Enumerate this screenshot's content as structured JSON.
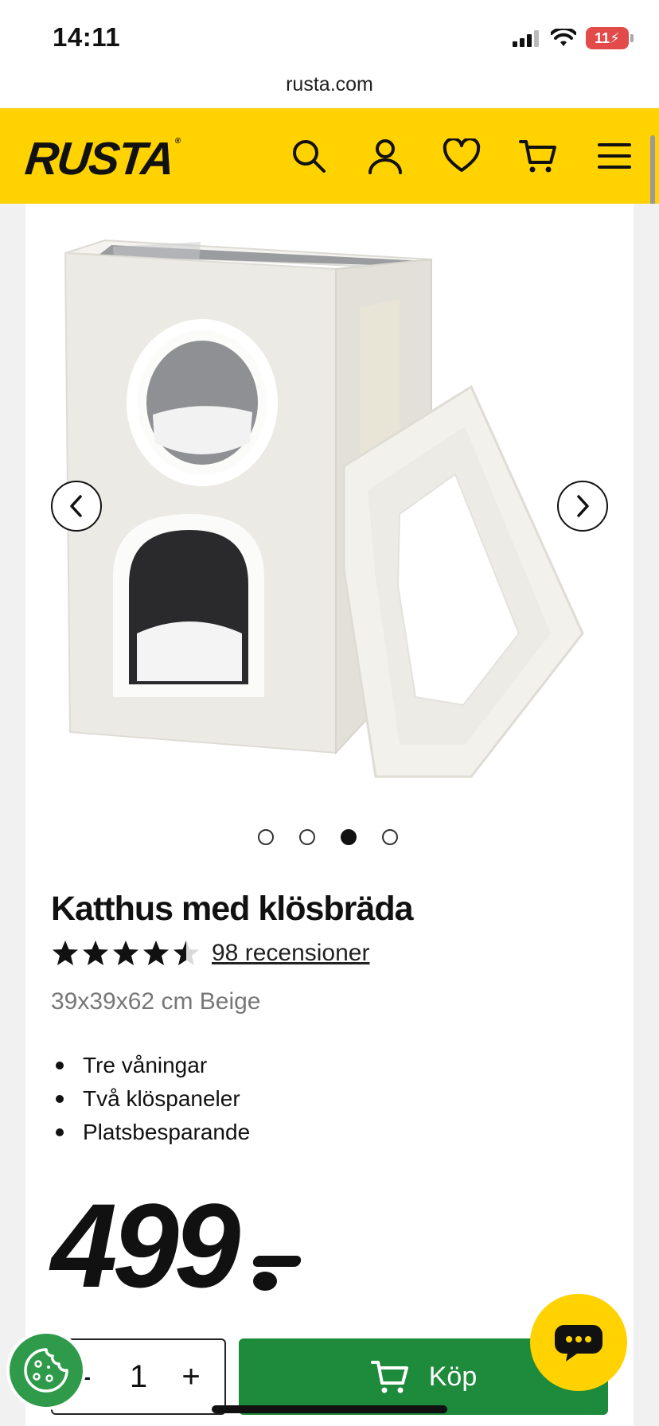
{
  "status_bar": {
    "time": "14:11",
    "battery": "11"
  },
  "browser": {
    "url": "rusta.com"
  },
  "header": {
    "logo": "RUSTA",
    "logo_mark": "®"
  },
  "gallery": {
    "slide_count": 4,
    "active_index": 2
  },
  "product": {
    "title": "Katthus med klösbräda",
    "rating": 4.5,
    "reviews_label": "98 recensioner",
    "variant": "39x39x62 cm Beige",
    "features": [
      "Tre våningar",
      "Två klöspaneler",
      "Platsbesparande"
    ],
    "price": "499"
  },
  "purchase": {
    "minus": "-",
    "quantity": "1",
    "plus": "+",
    "buy_label": "Köp"
  },
  "colors": {
    "brand_yellow": "#ffd200",
    "buy_green": "#1e8a3c",
    "cookie_green": "#2f9a4a"
  }
}
